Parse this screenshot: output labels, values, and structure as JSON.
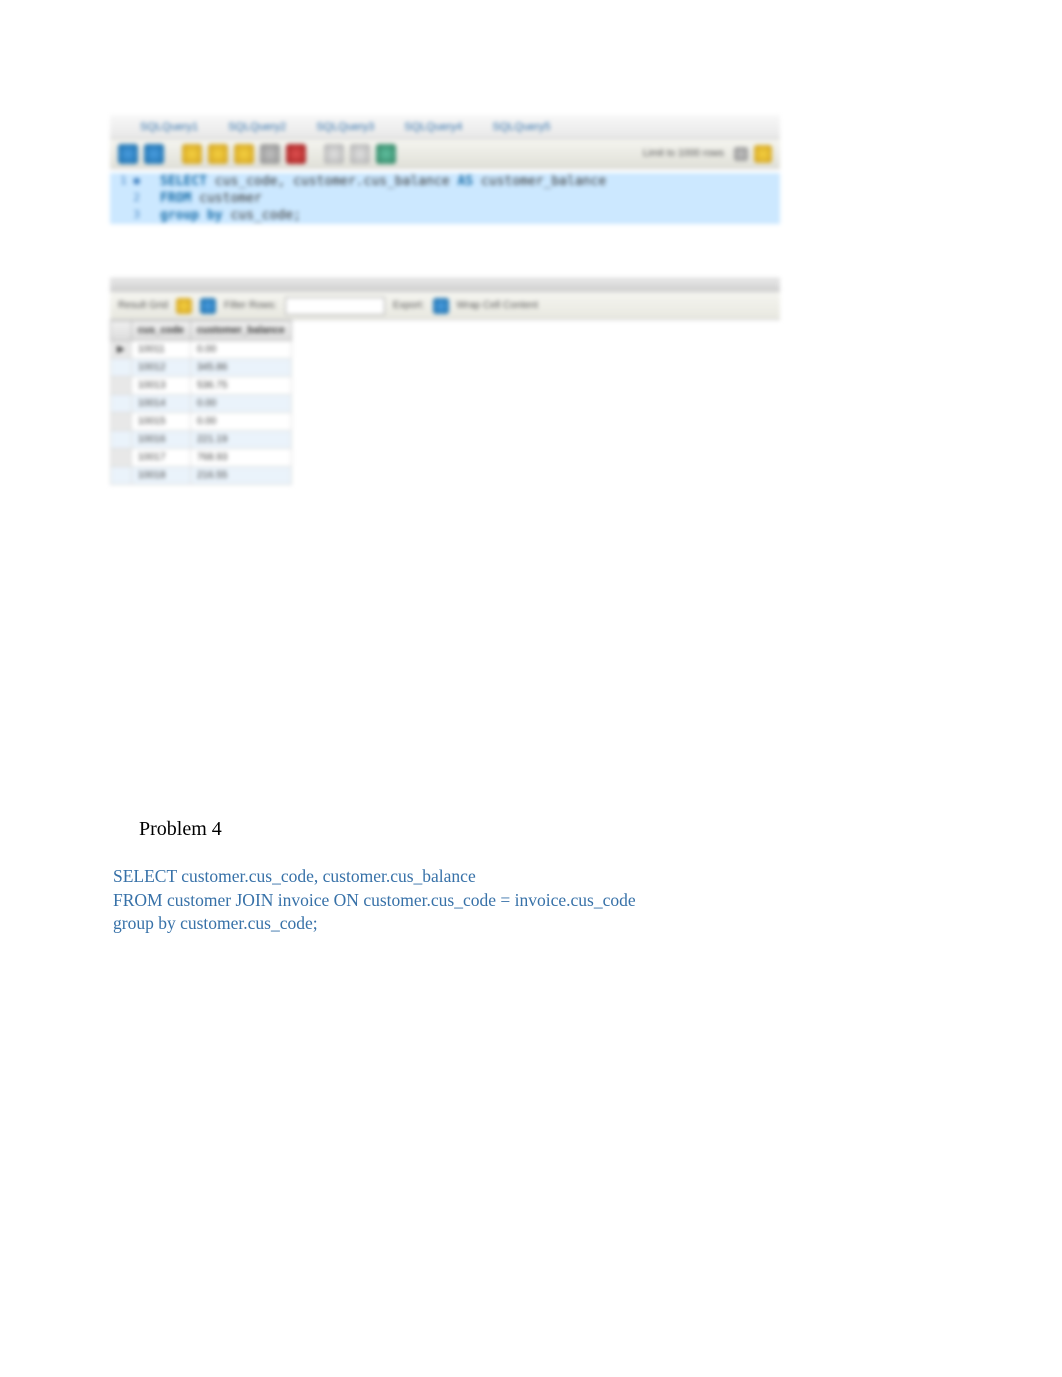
{
  "tabs": [
    "SQLQuery1",
    "SQLQuery2",
    "SQLQuery3",
    "SQLQuery4",
    "SQLQuery5"
  ],
  "toolbar": {
    "limit_label": "Limit to 1000 rows"
  },
  "sql_lines": [
    {
      "num": "1",
      "marker": "●",
      "content": [
        {
          "t": "SELECT ",
          "c": "kw-blue"
        },
        {
          "t": "cus_code, customer.cus_balance ",
          "c": "kw-dark"
        },
        {
          "t": "AS",
          "c": "kw-blue"
        },
        {
          "t": " customer_balance",
          "c": "kw-dark"
        }
      ],
      "hl": true
    },
    {
      "num": "2",
      "marker": "",
      "content": [
        {
          "t": "FROM ",
          "c": "kw-blue"
        },
        {
          "t": "customer",
          "c": "kw-dark"
        }
      ],
      "hl": true
    },
    {
      "num": "3",
      "marker": "",
      "content": [
        {
          "t": "group by ",
          "c": "kw-blue"
        },
        {
          "t": "cus_code;",
          "c": "kw-dark"
        }
      ],
      "hl": true
    }
  ],
  "results": {
    "toolbar": {
      "result_label": "Result Grid",
      "filter_label": "Filter Rows:",
      "export_label": "Export:",
      "wrap_label": "Wrap Cell Content"
    },
    "columns": [
      "cus_code",
      "customer_balance"
    ],
    "rows": [
      [
        "10011",
        "0.00"
      ],
      [
        "10012",
        "345.86"
      ],
      [
        "10013",
        "536.75"
      ],
      [
        "10014",
        "0.00"
      ],
      [
        "10015",
        "0.00"
      ],
      [
        "10016",
        "221.19"
      ],
      [
        "10017",
        "768.93"
      ],
      [
        "10018",
        "216.55"
      ]
    ]
  },
  "document": {
    "heading": "Problem 4",
    "sql_line1": "SELECT customer.cus_code, customer.cus_balance",
    "sql_line2": "FROM customer JOIN invoice ON customer.cus_code = invoice.cus_code",
    "sql_line3": "group by customer.cus_code;"
  }
}
